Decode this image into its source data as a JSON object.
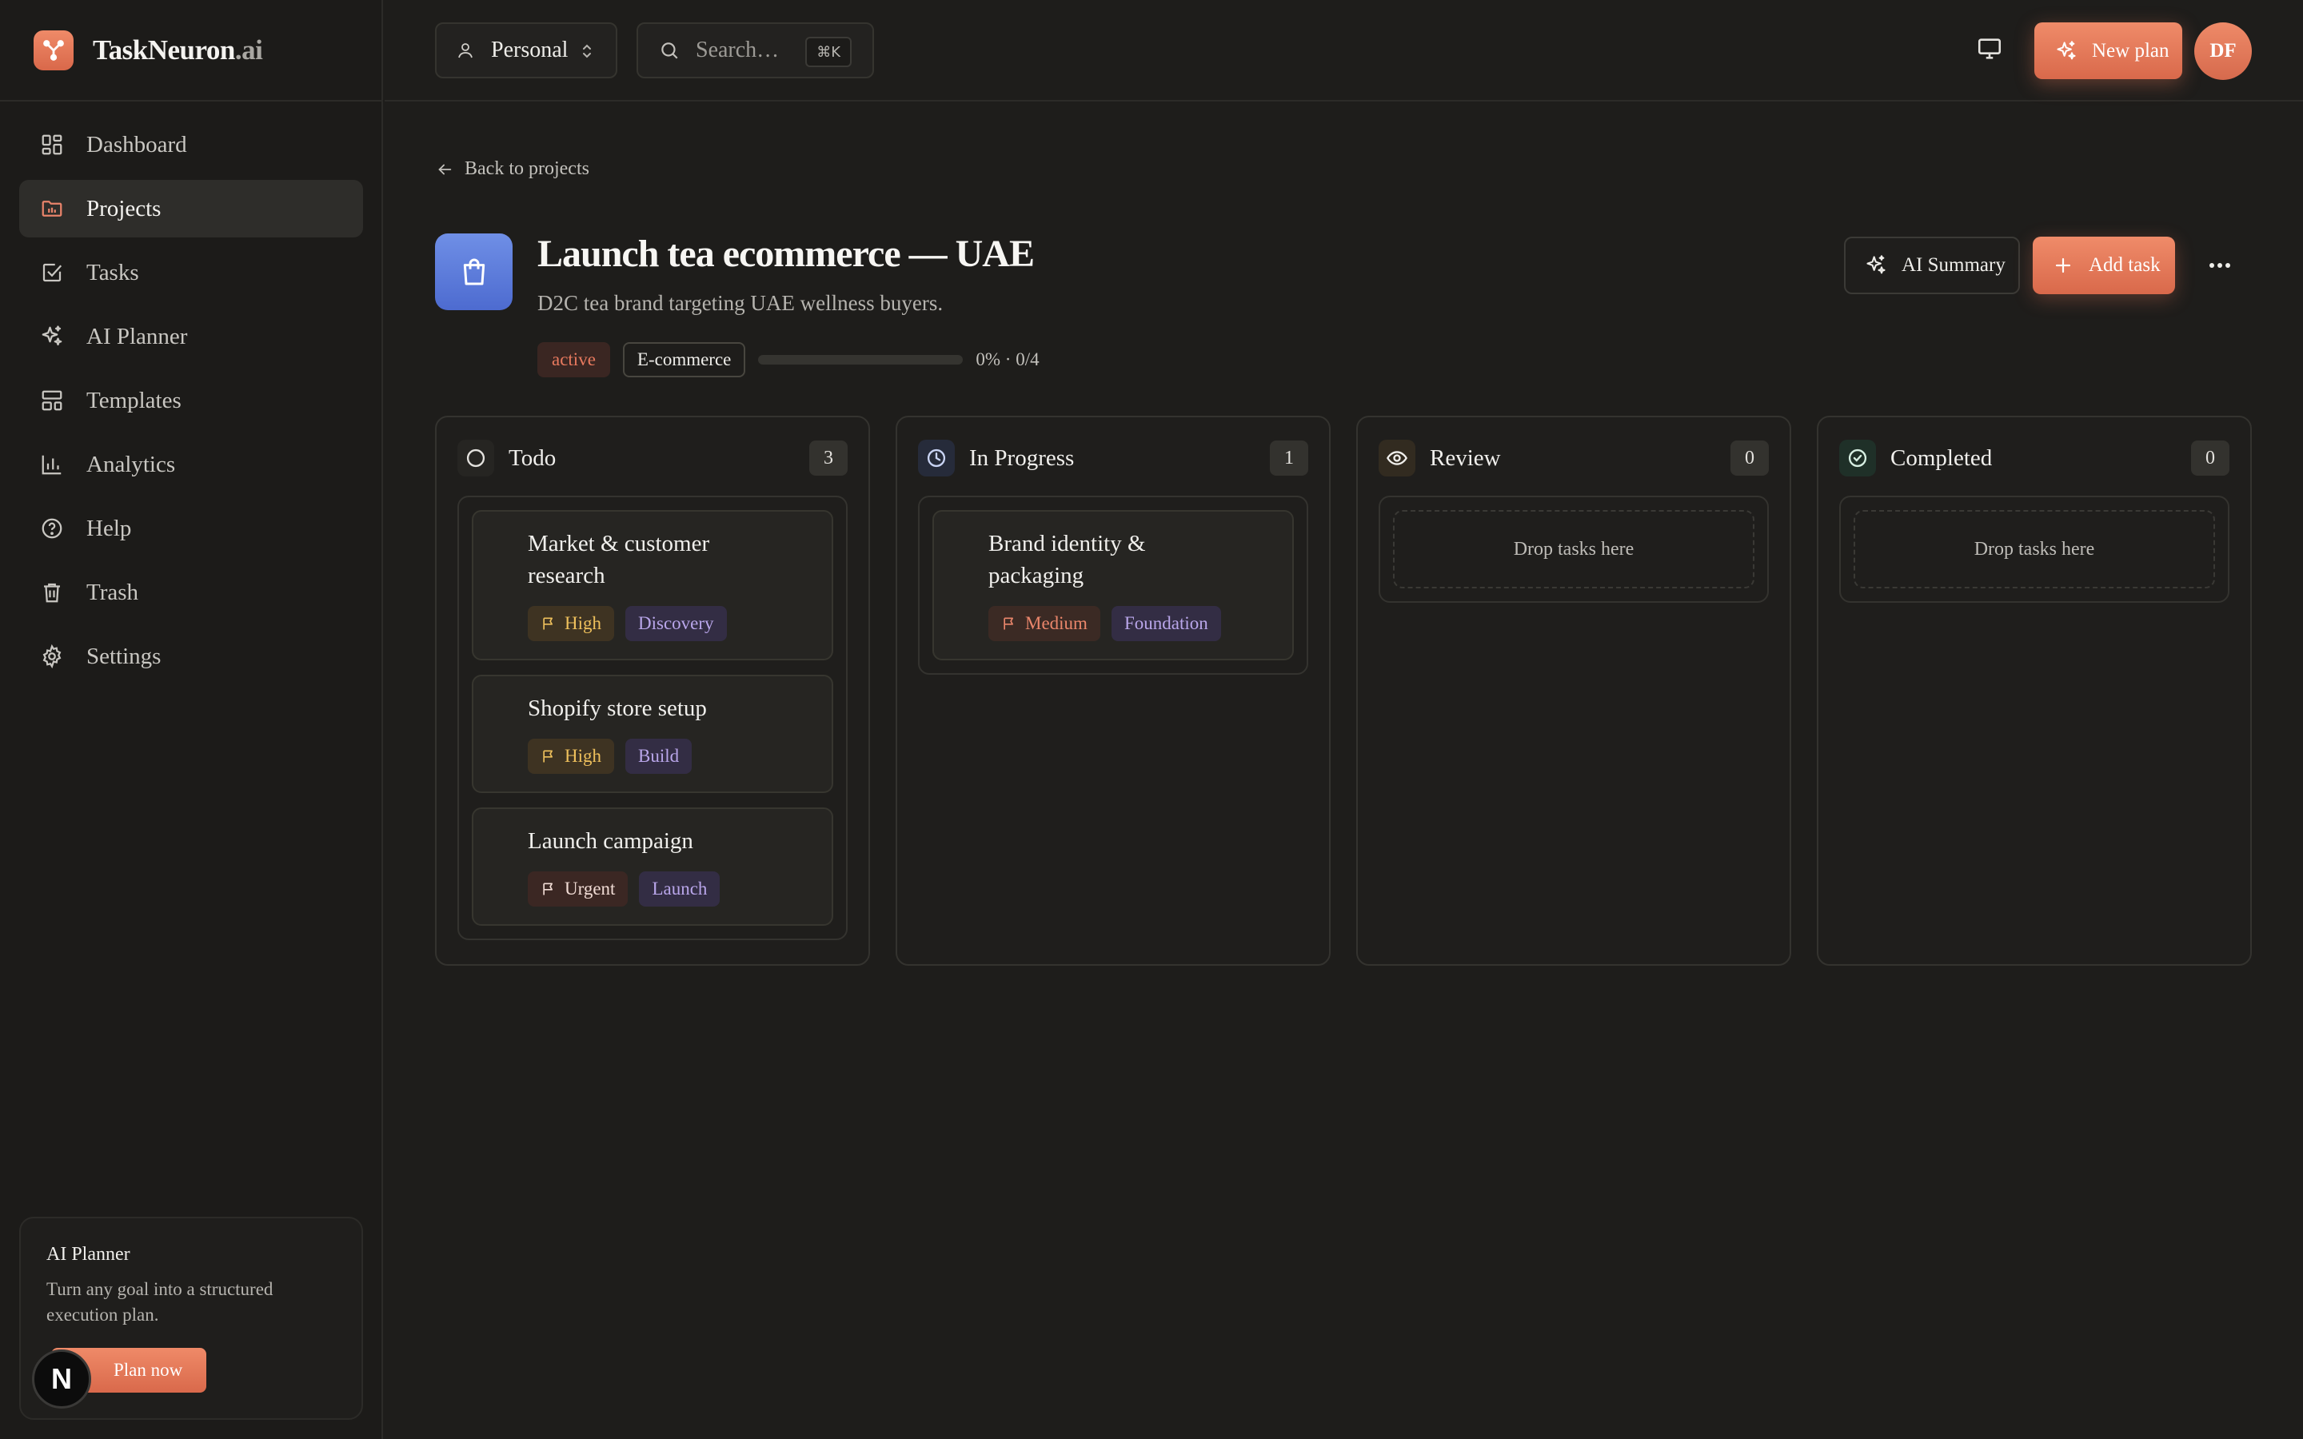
{
  "brand": {
    "name": "TaskNeuron",
    "tld": ".ai"
  },
  "sidebar": {
    "items": [
      {
        "label": "Dashboard",
        "icon": "dashboard-icon"
      },
      {
        "label": "Projects",
        "icon": "folder-icon"
      },
      {
        "label": "Tasks",
        "icon": "check-square-icon"
      },
      {
        "label": "AI Planner",
        "icon": "sparkles-icon"
      },
      {
        "label": "Templates",
        "icon": "template-icon"
      },
      {
        "label": "Analytics",
        "icon": "bar-chart-icon"
      },
      {
        "label": "Help",
        "icon": "help-icon"
      },
      {
        "label": "Trash",
        "icon": "trash-icon"
      },
      {
        "label": "Settings",
        "icon": "gear-icon"
      }
    ],
    "active_item": "Projects",
    "promo": {
      "title": "AI Planner",
      "text": "Turn any goal into a structured execution plan.",
      "button": "Plan now"
    },
    "badge_letter": "N"
  },
  "header": {
    "workspace": "Personal",
    "search_placeholder": "Search…",
    "search_shortcut": "⌘K",
    "new_plan_label": "New plan",
    "avatar_initials": "DF"
  },
  "project": {
    "back_label": "Back to projects",
    "title": "Launch tea ecommerce — UAE",
    "description": "D2C tea brand targeting UAE wellness buyers.",
    "status": "active",
    "category": "E-commerce",
    "progress_percent": 0,
    "progress_text": "0% · 0/4",
    "ai_summary_label": "AI Summary",
    "add_task_label": "Add task"
  },
  "board": {
    "empty_text": "Drop tasks here",
    "columns": [
      {
        "title": "Todo",
        "count": "3",
        "icon": "circle-icon",
        "icon_bg": "#262522",
        "icon_color": "#e4e2de",
        "tasks": [
          {
            "title": "Market & customer research",
            "priority": "High",
            "phase": "Discovery"
          },
          {
            "title": "Shopify store setup",
            "priority": "High",
            "phase": "Build"
          },
          {
            "title": "Launch campaign",
            "priority": "Urgent",
            "phase": "Launch"
          }
        ]
      },
      {
        "title": "In Progress",
        "count": "1",
        "icon": "clock-icon",
        "icon_bg": "#262b3a",
        "icon_color": "#c9d4f4",
        "tasks": [
          {
            "title": "Brand identity & packaging",
            "priority": "Medium",
            "phase": "Foundation"
          }
        ]
      },
      {
        "title": "Review",
        "count": "0",
        "icon": "eye-icon",
        "icon_bg": "#322b20",
        "icon_color": "#f0efec",
        "tasks": []
      },
      {
        "title": "Completed",
        "count": "0",
        "icon": "check-circle-icon",
        "icon_bg": "#1f3028",
        "icon_color": "#d7efe2",
        "tasks": []
      }
    ]
  },
  "colors": {
    "accent": "#e8836a",
    "background": "#1e1d1b",
    "project_icon": "#5b7ad9"
  }
}
